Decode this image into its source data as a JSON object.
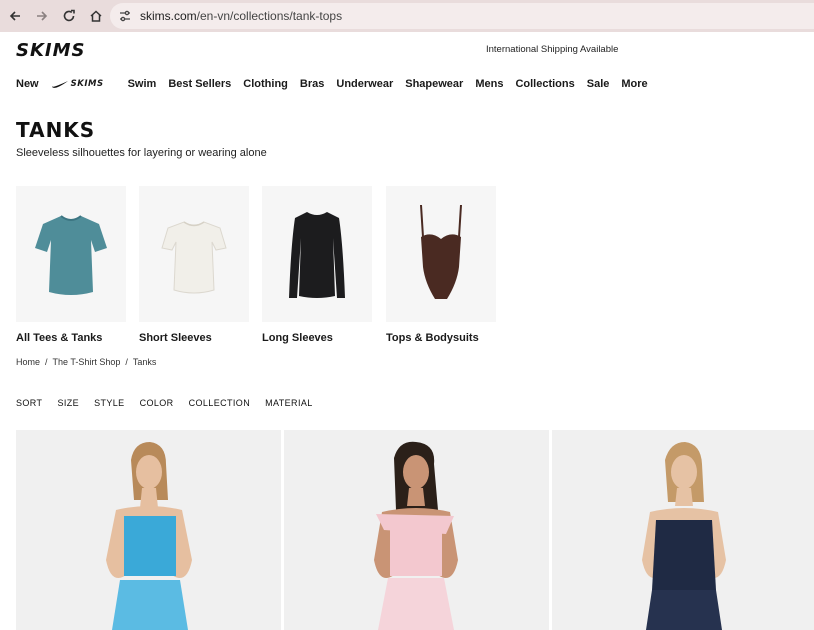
{
  "browser": {
    "url_host": "skims.com",
    "url_path": "/en-vn/collections/tank-tops"
  },
  "header": {
    "logo": "SKIMS",
    "shipping": "International Shipping Available"
  },
  "nav": {
    "items": [
      "New",
      "Swim",
      "Best Sellers",
      "Clothing",
      "Bras",
      "Underwear",
      "Shapewear",
      "Mens",
      "Collections",
      "Sale",
      "More"
    ],
    "nike_label": "SKIMS"
  },
  "page": {
    "title": "TANKS",
    "subtitle": "Sleeveless silhouettes for layering or wearing alone"
  },
  "categories": [
    {
      "label": "All Tees & Tanks",
      "icon": "teal-tee-icon",
      "color": "#4f8d99"
    },
    {
      "label": "Short Sleeves",
      "icon": "white-tee-icon",
      "color": "#f1efe9"
    },
    {
      "label": "Long Sleeves",
      "icon": "black-longsleeve-icon",
      "color": "#1c1c1e"
    },
    {
      "label": "Tops & Bodysuits",
      "icon": "brown-bodysuit-icon",
      "color": "#4a2a22"
    }
  ],
  "breadcrumb": [
    "Home",
    "/",
    "The T-Shirt Shop",
    "/",
    "Tanks"
  ],
  "filters": [
    "SORT",
    "SIZE",
    "STYLE",
    "COLOR",
    "COLLECTION",
    "MATERIAL"
  ],
  "products": [
    {
      "name": "blue-tube-tank",
      "color": "#3aa9d8"
    },
    {
      "name": "pink-off-shoulder-tank",
      "color": "#f3c8cf"
    },
    {
      "name": "navy-tube-tank",
      "color": "#1f2a44"
    }
  ]
}
